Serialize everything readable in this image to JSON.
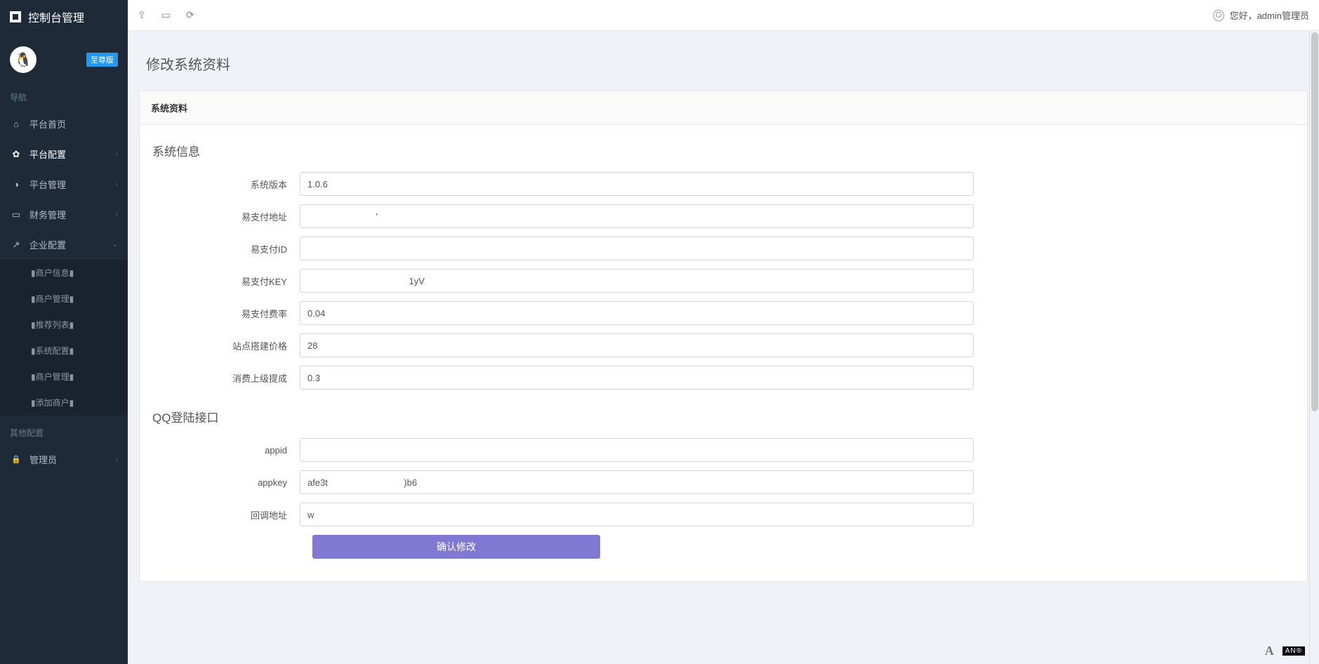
{
  "app_title": "控制台管理",
  "avatar_badge": "至尊版",
  "nav": {
    "section1": "导航",
    "items": [
      {
        "label": "平台首页",
        "icon": "home"
      },
      {
        "label": "平台配置",
        "icon": "gear",
        "active": true
      },
      {
        "label": "平台管理",
        "icon": "db"
      },
      {
        "label": "财务管理",
        "icon": "card"
      },
      {
        "label": "企业配置",
        "icon": "ext"
      }
    ],
    "sub": [
      "▮商户信息▮",
      "▮商户管理▮",
      "▮推荐列表▮",
      "▮系统配置▮",
      "▮商户管理▮",
      "▮添加商户▮"
    ],
    "section2": "其他配置",
    "items2": [
      {
        "label": "管理员",
        "icon": "user"
      }
    ]
  },
  "topbar": {
    "greeting": "您好，admin管理员"
  },
  "page": {
    "title": "修改系统资料",
    "panel_head": "系统资料",
    "section1": "系统信息",
    "section2": "QQ登陆接口",
    "fields": {
      "version_label": "系统版本",
      "version_value": "1.0.6",
      "epay_url_label": "易支付地址",
      "epay_url_value": "                           '",
      "epay_id_label": "易支付ID",
      "epay_id_value": "",
      "epay_key_label": "易支付KEY",
      "epay_key_value": "                                        1yV",
      "epay_rate_label": "易支付费率",
      "epay_rate_value": "0.04",
      "site_price_label": "站点搭建价格",
      "site_price_value": "28",
      "commission_label": "消费上级提成",
      "commission_value": "0.3",
      "appid_label": "appid",
      "appid_value": "",
      "appkey_label": "appkey",
      "appkey_value": "afe3t                              )b6",
      "callback_label": "回调地址",
      "callback_value": "w"
    },
    "submit": "确认修改"
  },
  "footer": {
    "text": "",
    "tag": "AN®"
  }
}
